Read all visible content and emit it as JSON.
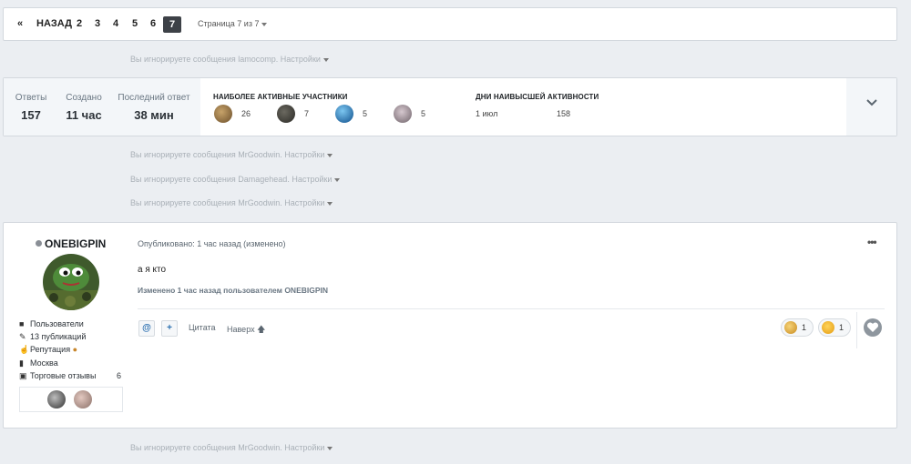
{
  "pagination": {
    "first_icon": "«",
    "prev_label": "НАЗАД",
    "pages": [
      "2",
      "3",
      "4",
      "5",
      "6"
    ],
    "current_page": "7",
    "page_info": "Страница 7 из 7"
  },
  "ignored_messages": [
    {
      "text": "Вы игнорируете сообщения lamocomp. Настройки"
    },
    {
      "text": "Вы игнорируете сообщения MrGoodwin. Настройки"
    },
    {
      "text": "Вы игнорируете сообщения Damagehead. Настройки"
    },
    {
      "text": "Вы игнорируете сообщения MrGoodwin. Настройки"
    },
    {
      "text": "Вы игнорируете сообщения MrGoodwin. Настройки"
    }
  ],
  "stats": {
    "replies_label": "Ответы",
    "replies_value": "157",
    "created_label": "Создано",
    "created_value": "11 час",
    "last_reply_label": "Последний ответ",
    "last_reply_value": "38 мин",
    "active_title": "НАИБОЛЕЕ АКТИВНЫЕ УЧАСТНИКИ",
    "active_users": [
      {
        "count": "26",
        "color": "#8a6a3f"
      },
      {
        "count": "7",
        "color": "#3b3a36"
      },
      {
        "count": "5",
        "color": "#1f6fb4"
      },
      {
        "count": "5",
        "color": "#9b8f98"
      }
    ],
    "peak_title": "ДНИ НАИВЫСШЕЙ АКТИВНОСТИ",
    "peak_day": "1 июл",
    "peak_count": "158",
    "expand_icon": "⌄"
  },
  "post": {
    "author": "ONEBIGPIN",
    "group": "Пользователи",
    "posts": "13 публикаций",
    "reputation": "Репутация",
    "location": "Москва",
    "feedback_label": "Торговые отзывы",
    "feedback_count": "6",
    "meta": "Опубликовано: 1 час назад (изменено)",
    "menu_icon": "•••",
    "content": "а я кто",
    "edited_note": "Изменено 1 час назад пользователем ONEBIGPIN",
    "mention_icon": "@",
    "plus_icon": "+",
    "quote_label": "Цитата",
    "top_label": "Наверх",
    "reactions": [
      {
        "count": "1",
        "color": "#e7b64a"
      },
      {
        "count": "1",
        "color": "#f0b429"
      }
    ]
  }
}
